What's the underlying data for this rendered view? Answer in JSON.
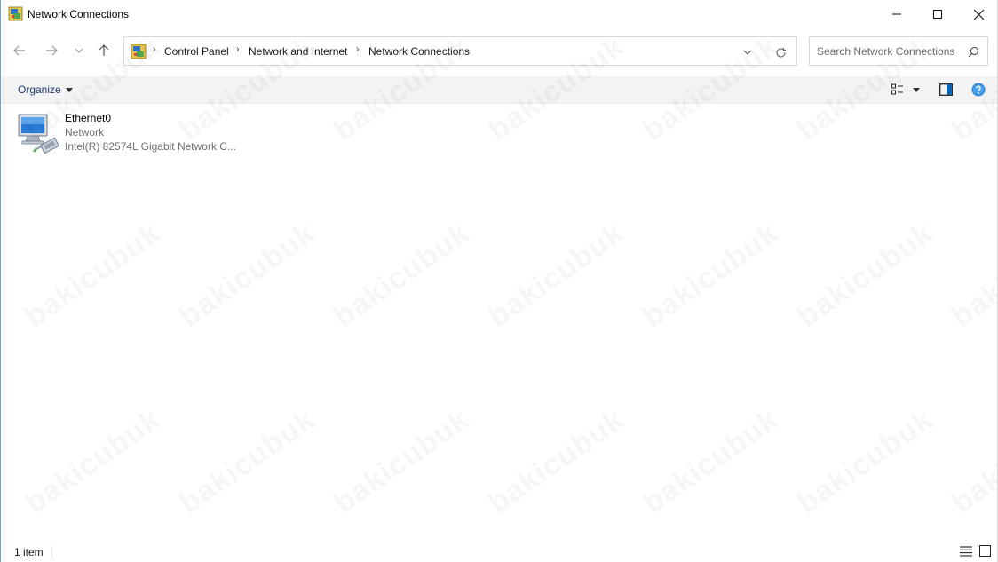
{
  "window": {
    "title": "Network Connections",
    "icon": "network-connections-icon"
  },
  "titlebar_buttons": {
    "minimize": "minimize-icon",
    "maximize": "maximize-icon",
    "close": "close-icon"
  },
  "navigation": {
    "back": "arrow-left-icon",
    "forward": "arrow-right-icon",
    "recent": "chevron-down-icon",
    "up": "arrow-up-icon"
  },
  "address": {
    "breadcrumbs": [
      "Control Panel",
      "Network and Internet",
      "Network Connections"
    ]
  },
  "search": {
    "placeholder": "Search Network Connections",
    "value": ""
  },
  "toolbar": {
    "organize_label": "Organize"
  },
  "items": [
    {
      "name": "Ethernet0",
      "status": "Network",
      "device": "Intel(R) 82574L Gigabit Network C...",
      "icon": "ethernet-adapter-icon"
    }
  ],
  "statusbar": {
    "item_count": "1 item"
  },
  "watermark": {
    "text": "bakicubuk"
  },
  "colors": {
    "accent": "#0067c0",
    "command_bar": "#f3f3f3",
    "secondary_text": "#6d6d6d"
  }
}
